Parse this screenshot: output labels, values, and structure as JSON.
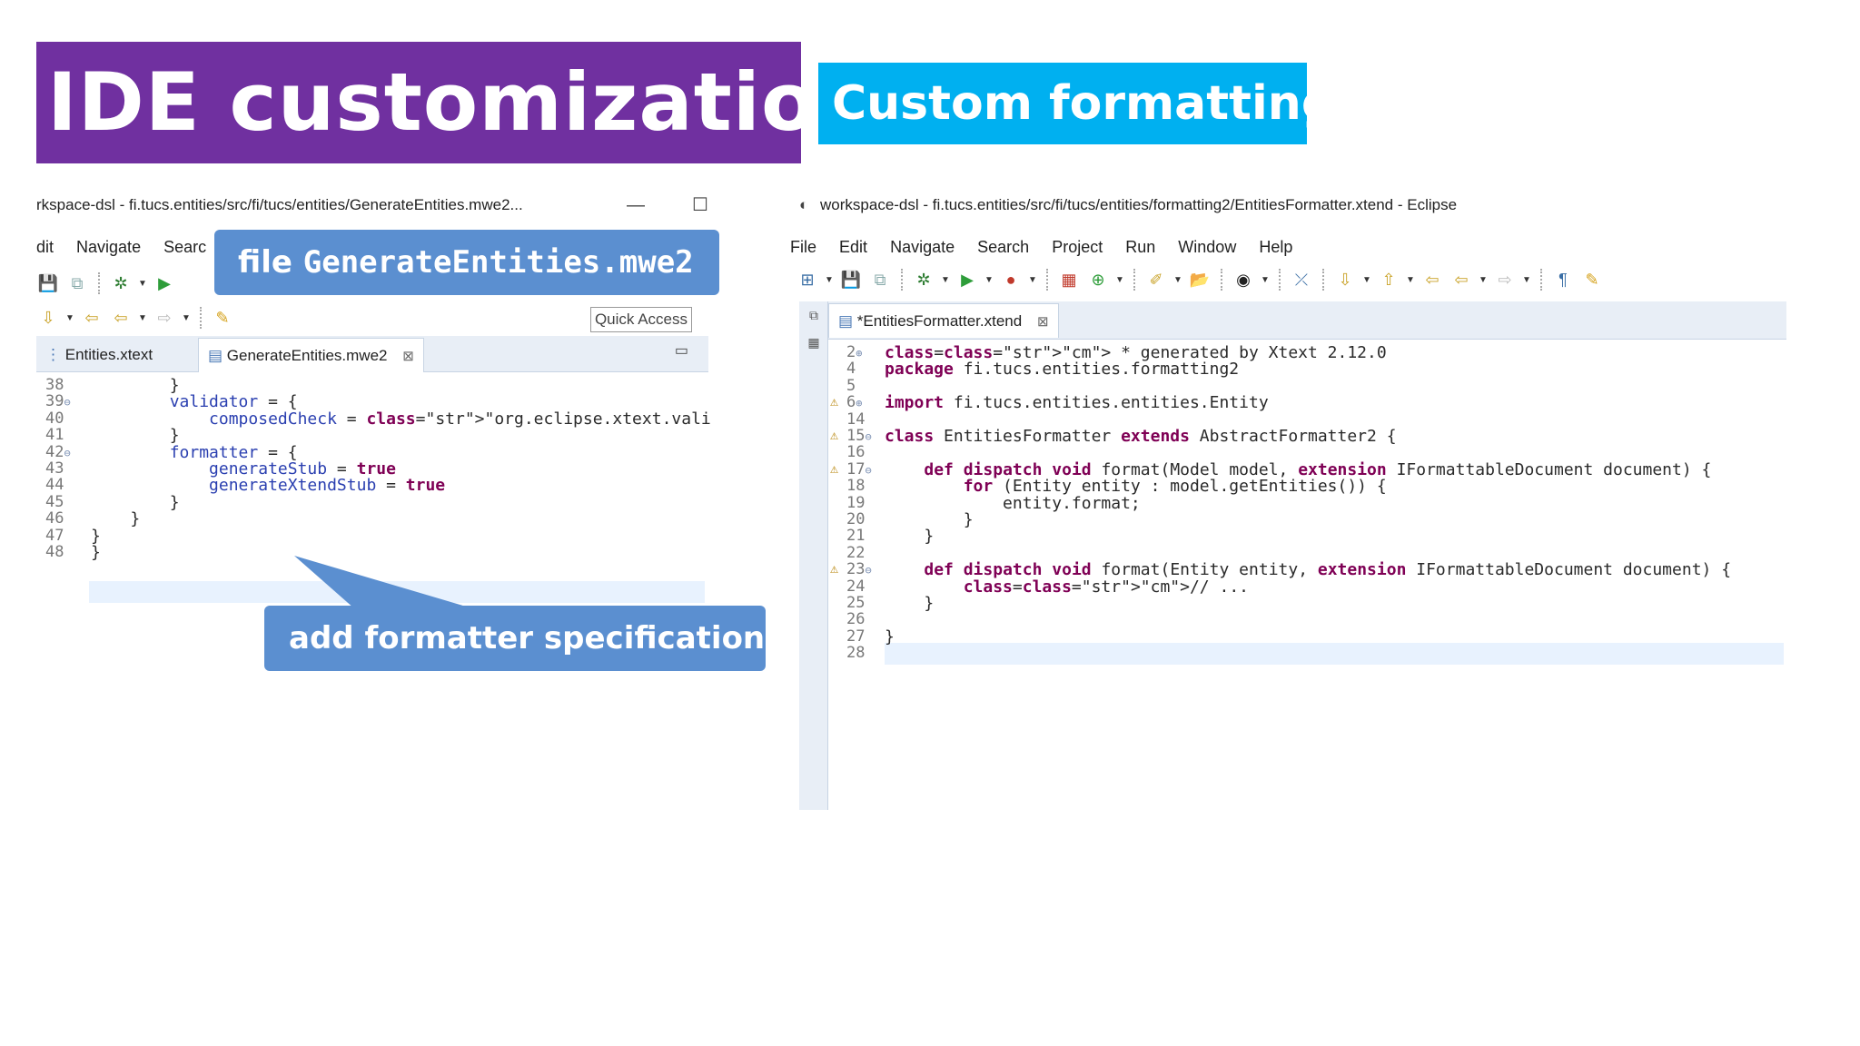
{
  "slide": {
    "title": "IDE customizations",
    "subtitle": "Custom formatting",
    "callout_file_prefix": "file ",
    "callout_file_name": "GenerateEntities.mwe2",
    "callout_add": "add formatter specification"
  },
  "colors": {
    "title_bg": "#7030a0",
    "subtitle_bg": "#00b0f0",
    "callout_bg": "#5b8fd0",
    "keyword": "#7f0055",
    "string": "#2a00ff",
    "comment": "#3f7f5f"
  },
  "left_window": {
    "title": "rkspace-dsl - fi.tucs.entities/src/fi/tucs/entities/GenerateEntities.mwe2...",
    "menu": [
      "dit",
      "Navigate",
      "Searc"
    ],
    "quick_access": "Quick Access",
    "tabs": [
      {
        "label": "Entities.xtext",
        "active": false
      },
      {
        "label": "GenerateEntities.mwe2",
        "active": true
      }
    ],
    "lines": [
      {
        "num": "38",
        "text": "        }"
      },
      {
        "num": "39",
        "fold": true,
        "text": "        validator = {"
      },
      {
        "num": "40",
        "text": "            composedCheck = \"org.eclipse.xtext.validatio"
      },
      {
        "num": "41",
        "text": "        }"
      },
      {
        "num": "42",
        "fold": true,
        "text": "        formatter = {"
      },
      {
        "num": "43",
        "text": "            generateStub = true"
      },
      {
        "num": "44",
        "text": "            generateXtendStub = true"
      },
      {
        "num": "45",
        "text": "        }"
      },
      {
        "num": "46",
        "text": "    }"
      },
      {
        "num": "47",
        "text": "}"
      },
      {
        "num": "48",
        "text": "}"
      }
    ]
  },
  "right_window": {
    "title": "workspace-dsl - fi.tucs.entities/src/fi/tucs/entities/formatting2/EntitiesFormatter.xtend - Eclipse",
    "menu": [
      "File",
      "Edit",
      "Navigate",
      "Search",
      "Project",
      "Run",
      "Window",
      "Help"
    ],
    "tab": "*EntitiesFormatter.xtend",
    "lines": [
      {
        "num": "2",
        "marker": "expand",
        "text": " * generated by Xtext 2.12.0"
      },
      {
        "num": "4",
        "text": "package fi.tucs.entities.formatting2"
      },
      {
        "num": "5",
        "text": ""
      },
      {
        "num": "6",
        "marker": "expand",
        "warn": true,
        "text": "import fi.tucs.entities.entities.Entity"
      },
      {
        "num": "14",
        "text": ""
      },
      {
        "num": "15",
        "marker": "fold",
        "warn": true,
        "text": "class EntitiesFormatter extends AbstractFormatter2 {"
      },
      {
        "num": "16",
        "text": ""
      },
      {
        "num": "17",
        "marker": "fold",
        "warn": true,
        "text": "    def dispatch void format(Model model, extension IFormattableDocument document) {"
      },
      {
        "num": "18",
        "text": "        for (Entity entity : model.getEntities()) {"
      },
      {
        "num": "19",
        "text": "            entity.format;"
      },
      {
        "num": "20",
        "text": "        }"
      },
      {
        "num": "21",
        "text": "    }"
      },
      {
        "num": "22",
        "text": ""
      },
      {
        "num": "23",
        "marker": "fold",
        "warn": true,
        "text": "    def dispatch void format(Entity entity, extension IFormattableDocument document) {"
      },
      {
        "num": "24",
        "text": "        // ..."
      },
      {
        "num": "25",
        "text": "    }"
      },
      {
        "num": "26",
        "text": ""
      },
      {
        "num": "27",
        "text": "}"
      },
      {
        "num": "28",
        "text": ""
      }
    ]
  }
}
